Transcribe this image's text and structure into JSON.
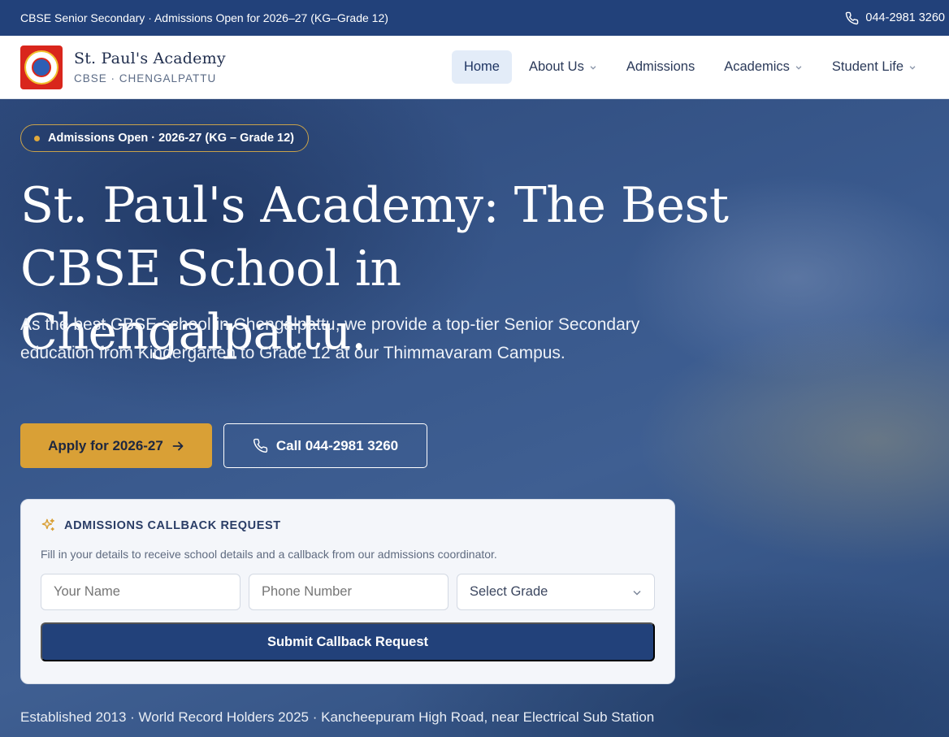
{
  "topbar": {
    "announcement": "CBSE Senior Secondary · Admissions Open for 2026–27 (KG–Grade 12)",
    "phone": "044-2981 3260"
  },
  "brand": {
    "name": "St. Paul's Academy",
    "tagline": "CBSE · CHENGALPATTU"
  },
  "nav": {
    "items": [
      {
        "label": "Home",
        "active": true,
        "dropdown": false
      },
      {
        "label": "About Us",
        "active": false,
        "dropdown": true
      },
      {
        "label": "Admissions",
        "active": false,
        "dropdown": false
      },
      {
        "label": "Academics",
        "active": false,
        "dropdown": true
      },
      {
        "label": "Student Life",
        "active": false,
        "dropdown": true
      }
    ]
  },
  "hero": {
    "badge": "Admissions Open · 2026-27 (KG – Grade 12)",
    "headline_line1": "St. Paul's Academy: The Best",
    "headline_line2": "CBSE School in Chengalpattu.",
    "lead": "As the best CBSE school in Chengalpattu, we provide a top-tier Senior Secondary education from Kindergarten to Grade 12 at our Thimmavaram Campus.",
    "apply_label": "Apply for 2026-27",
    "call_label": "Call 044-2981 3260",
    "footnote": "Established 2013 · World Record Holders 2025 · Kancheepuram High Road, near Electrical Sub Station"
  },
  "callback_form": {
    "title": "ADMISSIONS CALLBACK REQUEST",
    "description": "Fill in your details to receive school details and a callback from our admissions coordinator.",
    "name_placeholder": "Your Name",
    "phone_placeholder": "Phone Number",
    "grade_selected": "Select Grade",
    "submit_label": "Submit Callback Request"
  },
  "colors": {
    "primary": "#22417a",
    "accent_gold": "#d9a036",
    "nav_active_bg": "#e3ecf8"
  }
}
